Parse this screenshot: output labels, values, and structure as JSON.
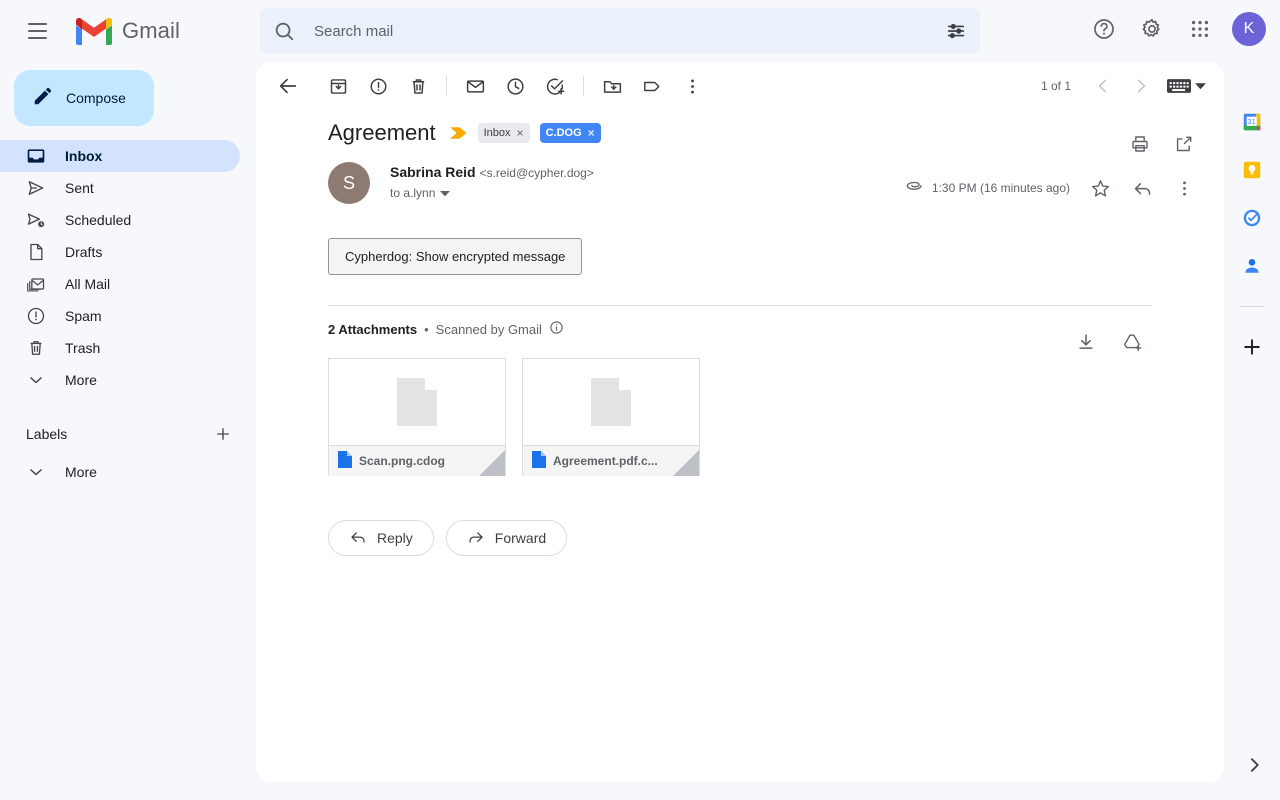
{
  "app": {
    "name": "Gmail",
    "menu_icon": "hamburger-icon",
    "logo_icon": "gmail-logo-icon"
  },
  "search": {
    "placeholder": "Search mail",
    "value": "",
    "icon": "search-icon",
    "options_icon": "search-options-icon"
  },
  "header_actions": {
    "support": {
      "label": "Support",
      "icon": "help-icon"
    },
    "settings": {
      "label": "Settings",
      "icon": "gear-icon"
    },
    "apps": {
      "label": "Google apps",
      "icon": "apps-grid-icon"
    },
    "account": {
      "initial": "K",
      "color": "#6b63d6"
    }
  },
  "sidebar": {
    "compose": {
      "label": "Compose",
      "icon": "pencil-icon",
      "bg": "#c2e7ff"
    },
    "items": [
      {
        "label": "Inbox",
        "icon": "inbox-icon",
        "active": true
      },
      {
        "label": "Sent",
        "icon": "send-icon",
        "active": false
      },
      {
        "label": "Scheduled",
        "icon": "scheduled-icon",
        "active": false
      },
      {
        "label": "Drafts",
        "icon": "draft-icon",
        "active": false
      },
      {
        "label": "All Mail",
        "icon": "all-mail-icon",
        "active": false
      },
      {
        "label": "Spam",
        "icon": "spam-icon",
        "active": false
      },
      {
        "label": "Trash",
        "icon": "trash-icon",
        "active": false
      },
      {
        "label": "More",
        "icon": "chevron-down-icon",
        "active": false
      }
    ],
    "labels_header": {
      "title": "Labels",
      "add_icon": "plus-icon"
    },
    "labels_more": {
      "label": "More",
      "icon": "chevron-down-icon"
    }
  },
  "toolbar": {
    "back": {
      "label": "Back to Inbox",
      "icon": "arrow-back-icon"
    },
    "archive": {
      "label": "Archive",
      "icon": "archive-icon"
    },
    "spam": {
      "label": "Report spam",
      "icon": "report-spam-icon"
    },
    "delete": {
      "label": "Delete",
      "icon": "trash-icon"
    },
    "unread": {
      "label": "Mark as unread",
      "icon": "envelope-icon"
    },
    "snooze": {
      "label": "Snooze",
      "icon": "clock-icon"
    },
    "tasks": {
      "label": "Add to tasks",
      "icon": "add-task-icon"
    },
    "move": {
      "label": "Move to",
      "icon": "move-to-folder-icon"
    },
    "labels": {
      "label": "Labels",
      "icon": "label-tag-icon"
    },
    "more": {
      "label": "More",
      "icon": "more-vertical-icon"
    },
    "pager_count": "1 of 1",
    "prev": {
      "label": "Newer",
      "icon": "chevron-left-icon"
    },
    "next": {
      "label": "Older",
      "icon": "chevron-right-icon"
    },
    "keyboard": {
      "label": "Input tools",
      "icon": "keyboard-icon",
      "caret": "caret-down-icon"
    }
  },
  "thread": {
    "subject": "Agreement",
    "importance_marker": "importance-marker-icon",
    "chips": [
      {
        "label": "Inbox",
        "remove": "×",
        "style": "gray"
      },
      {
        "label": "C.DOG",
        "remove": "×",
        "style": "blue",
        "color": "#4285f4"
      }
    ],
    "print": {
      "label": "Print all",
      "icon": "print-icon"
    },
    "popout": {
      "label": "Open in new window",
      "icon": "open-in-new-icon"
    }
  },
  "message": {
    "avatar": {
      "initial": "S",
      "color": "#8d7b73"
    },
    "sender_name": "Sabrina Reid",
    "sender_email": "<s.reid@cypher.dog>",
    "recipient": "to a.lynn",
    "recipient_caret": "caret-down-icon",
    "attachment_icon": "paperclip-icon",
    "time": "1:30 PM (16 minutes ago)",
    "star": {
      "label": "Not starred",
      "icon": "star-outline-icon"
    },
    "reply_icon": {
      "label": "Reply",
      "icon": "reply-icon"
    },
    "more_icon": {
      "label": "More",
      "icon": "more-vertical-icon"
    },
    "encrypted_button": "Cypherdog: Show encrypted message"
  },
  "attachments": {
    "count_label": "2 Attachments",
    "separator": "•",
    "scanned_label": "Scanned by Gmail",
    "info_icon": "info-icon",
    "download_all": {
      "label": "Download all attachments",
      "icon": "download-icon"
    },
    "save_drive": {
      "label": "Save all to Drive",
      "icon": "add-to-drive-icon"
    },
    "items": [
      {
        "name": "Scan.png.cdog",
        "file_icon": "file-blue-icon",
        "thumb_icon": "document-placeholder-icon"
      },
      {
        "name": "Agreement.pdf.c...",
        "file_icon": "file-blue-icon",
        "thumb_icon": "document-placeholder-icon"
      }
    ]
  },
  "footer_actions": {
    "reply": {
      "label": "Reply",
      "icon": "reply-arrow-icon"
    },
    "forward": {
      "label": "Forward",
      "icon": "forward-arrow-icon"
    }
  },
  "right_rail": {
    "items": [
      {
        "name": "google-calendar-icon",
        "label": "Calendar",
        "day": "31"
      },
      {
        "name": "google-keep-icon",
        "label": "Keep"
      },
      {
        "name": "google-tasks-icon",
        "label": "Tasks"
      },
      {
        "name": "google-contacts-icon",
        "label": "Contacts"
      }
    ],
    "add": {
      "label": "Get add-ons",
      "icon": "plus-icon"
    },
    "expand": {
      "label": "Show side panel",
      "icon": "chevron-right-icon"
    }
  }
}
